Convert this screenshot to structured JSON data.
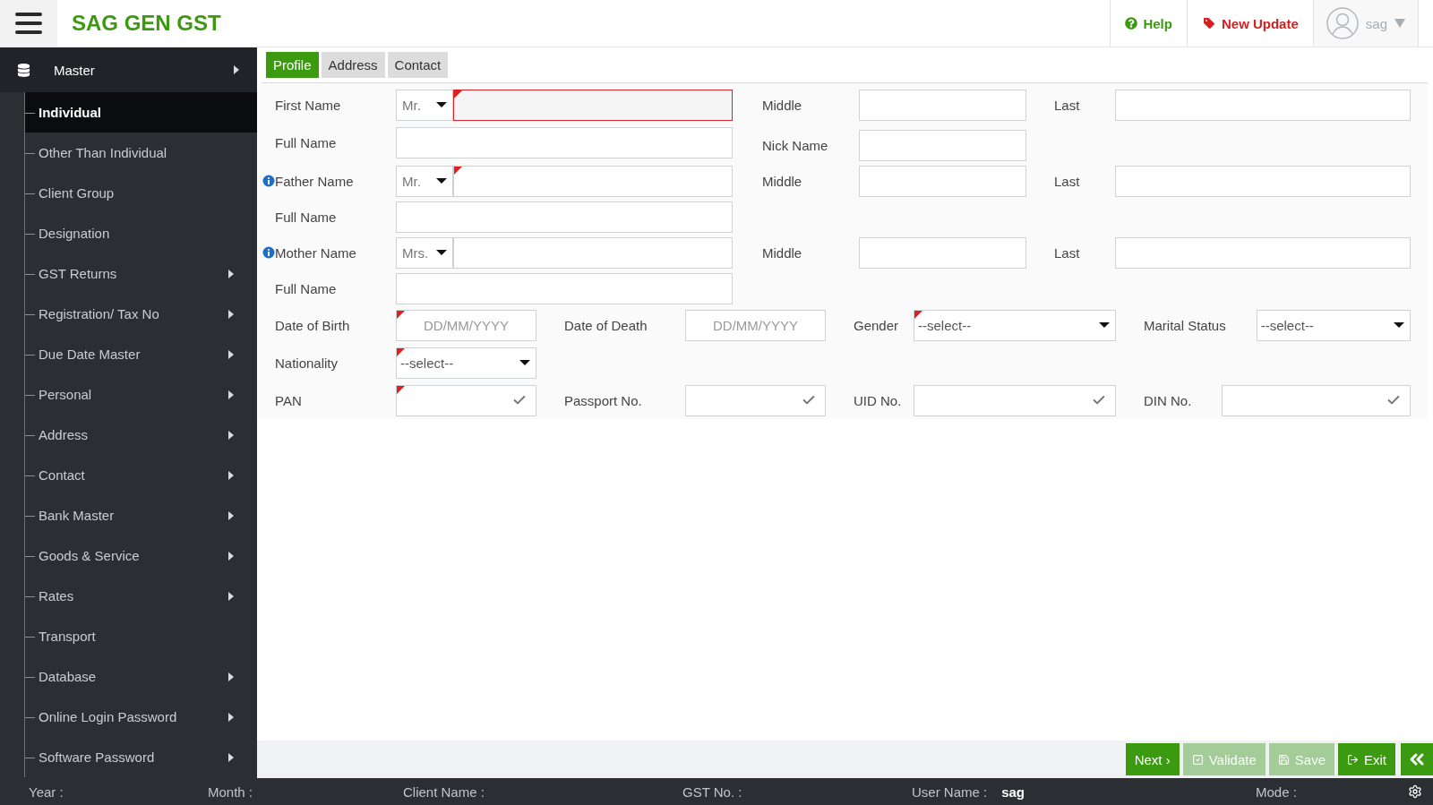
{
  "header": {
    "title": "SAG GEN GST",
    "help": "Help",
    "new_update": "New Update",
    "user": "sag"
  },
  "sidebar": {
    "master": {
      "label": "Master",
      "expanded": true
    },
    "items": [
      {
        "label": "Individual",
        "selected": true,
        "has_submenu": false
      },
      {
        "label": "Other Than Individual",
        "selected": false,
        "has_submenu": false
      },
      {
        "label": "Client Group",
        "selected": false,
        "has_submenu": false
      },
      {
        "label": "Designation",
        "selected": false,
        "has_submenu": false
      },
      {
        "label": "GST Returns",
        "selected": false,
        "has_submenu": true
      },
      {
        "label": "Registration/ Tax No",
        "selected": false,
        "has_submenu": true
      },
      {
        "label": "Due Date Master",
        "selected": false,
        "has_submenu": true
      },
      {
        "label": "Personal",
        "selected": false,
        "has_submenu": true
      },
      {
        "label": "Address",
        "selected": false,
        "has_submenu": true
      },
      {
        "label": "Contact",
        "selected": false,
        "has_submenu": true
      },
      {
        "label": "Bank Master",
        "selected": false,
        "has_submenu": true
      },
      {
        "label": "Goods & Service",
        "selected": false,
        "has_submenu": true
      },
      {
        "label": "Rates",
        "selected": false,
        "has_submenu": true
      },
      {
        "label": "Transport",
        "selected": false,
        "has_submenu": false
      },
      {
        "label": "Database",
        "selected": false,
        "has_submenu": true
      },
      {
        "label": "Online Login Password",
        "selected": false,
        "has_submenu": true
      },
      {
        "label": "Software Password",
        "selected": false,
        "has_submenu": true
      }
    ]
  },
  "tabs": [
    {
      "label": "Profile",
      "selected": true
    },
    {
      "label": "Address",
      "selected": false
    },
    {
      "label": "Contact",
      "selected": false
    }
  ],
  "form": [
    {
      "kind": "name",
      "label": "First Name",
      "info": false,
      "title": "Mr.",
      "required": true,
      "focused": true,
      "middle_label": "Middle",
      "last_label": "Last"
    },
    {
      "kind": "full",
      "label": "Full Name",
      "side_label": "Nick Name"
    },
    {
      "kind": "name",
      "label": "Father Name",
      "info": true,
      "title": "Mr.",
      "required": true,
      "focused": false,
      "middle_label": "Middle",
      "last_label": "Last"
    },
    {
      "kind": "full",
      "label": "Full Name"
    },
    {
      "kind": "name",
      "label": "Mother Name",
      "info": true,
      "title": "Mrs.",
      "required": false,
      "focused": false,
      "middle_label": "Middle",
      "last_label": "Last"
    },
    {
      "kind": "full",
      "label": "Full Name"
    },
    {
      "kind": "fields",
      "fields": [
        {
          "label": "Date of Birth",
          "kind": "date",
          "placeholder": "DD/MM/YYYY",
          "required": true
        },
        {
          "label": "Date of Death",
          "kind": "date",
          "placeholder": "DD/MM/YYYY",
          "required": false
        },
        {
          "label": "Gender",
          "kind": "select",
          "value": "--select--",
          "required": true
        },
        {
          "label": "Marital Status",
          "kind": "select",
          "value": "--select--",
          "required": false
        }
      ]
    },
    {
      "kind": "fields",
      "fields": [
        {
          "label": "Nationality",
          "kind": "select",
          "value": "--select--",
          "required": true
        }
      ]
    },
    {
      "kind": "fields",
      "fields": [
        {
          "label": "PAN",
          "kind": "check",
          "required": true
        },
        {
          "label": "Passport No.",
          "kind": "check",
          "required": false
        },
        {
          "label": "UID No.",
          "kind": "check",
          "required": false
        },
        {
          "label": "DIN No.",
          "kind": "check",
          "required": false
        }
      ]
    }
  ],
  "actions": [
    {
      "label": "Next ›",
      "kind": "next",
      "disabled": false
    },
    {
      "label": "Validate",
      "kind": "validate",
      "disabled": true
    },
    {
      "label": "Save",
      "kind": "save",
      "disabled": true
    },
    {
      "label": "Exit",
      "kind": "exit",
      "disabled": false
    }
  ],
  "status_bar": [
    {
      "label": "Year :"
    },
    {
      "label": "Month :"
    },
    {
      "label": "Client Name :"
    },
    {
      "label": "GST No. :"
    },
    {
      "label": "User Name :",
      "value": "sag"
    },
    {
      "label": "Mode :"
    }
  ]
}
